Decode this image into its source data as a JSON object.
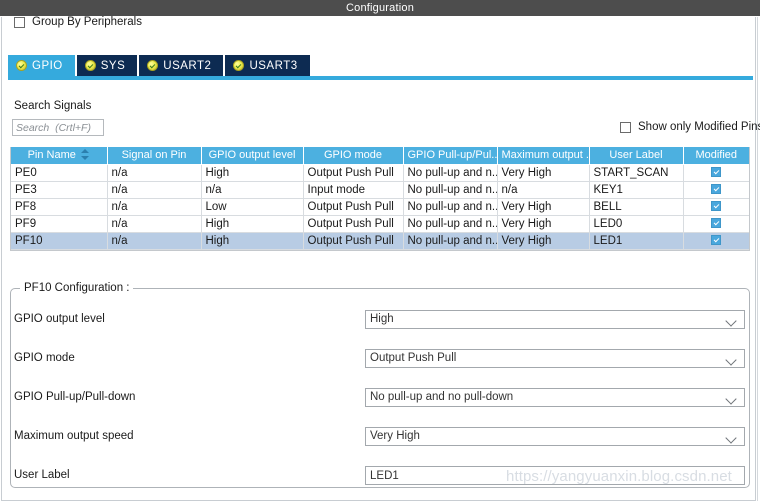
{
  "window": {
    "title": "Configuration"
  },
  "options": {
    "group_by_peripherals_label": "Group By Peripherals",
    "group_by_peripherals_checked": false,
    "show_only_modified_label": "Show only Modified Pins",
    "show_only_modified_checked": false
  },
  "tabs": [
    {
      "label": "GPIO",
      "active": true,
      "status": "configured"
    },
    {
      "label": "SYS",
      "active": false,
      "status": "configured"
    },
    {
      "label": "USART2",
      "active": false,
      "status": "configured"
    },
    {
      "label": "USART3",
      "active": false,
      "status": "configured"
    }
  ],
  "search": {
    "label": "Search Signals",
    "value": "",
    "placeholder": "Search  (Crtl+F)"
  },
  "table": {
    "columns": [
      "Pin Name",
      "Signal on Pin",
      "GPIO output level",
      "GPIO mode",
      "GPIO Pull-up/Pul...",
      "Maximum output ...",
      "User Label",
      "Modified"
    ],
    "sorted_column": "Pin Name",
    "rows": [
      {
        "pin_name": "PE0",
        "signal_on_pin": "n/a",
        "gpio_output_level": "High",
        "gpio_mode": "Output Push Pull",
        "gpio_pull": "No pull-up and n...",
        "max_output_speed": "Very High",
        "user_label": "START_SCAN",
        "modified": true,
        "selected": false
      },
      {
        "pin_name": "PE3",
        "signal_on_pin": "n/a",
        "gpio_output_level": "n/a",
        "gpio_mode": "Input mode",
        "gpio_pull": "No pull-up and n...",
        "max_output_speed": "n/a",
        "user_label": "KEY1",
        "modified": true,
        "selected": false
      },
      {
        "pin_name": "PF8",
        "signal_on_pin": "n/a",
        "gpio_output_level": "Low",
        "gpio_mode": "Output Push Pull",
        "gpio_pull": "No pull-up and n...",
        "max_output_speed": "Very High",
        "user_label": "BELL",
        "modified": true,
        "selected": false
      },
      {
        "pin_name": "PF9",
        "signal_on_pin": "n/a",
        "gpio_output_level": "High",
        "gpio_mode": "Output Push Pull",
        "gpio_pull": "No pull-up and n...",
        "max_output_speed": "Very High",
        "user_label": "LED0",
        "modified": true,
        "selected": false
      },
      {
        "pin_name": "PF10",
        "signal_on_pin": "n/a",
        "gpio_output_level": "High",
        "gpio_mode": "Output Push Pull",
        "gpio_pull": "No pull-up and n...",
        "max_output_speed": "Very High",
        "user_label": "LED1",
        "modified": true,
        "selected": true
      }
    ]
  },
  "detail": {
    "legend": "PF10 Configuration :",
    "fields": [
      {
        "label": "GPIO output level",
        "value": "High",
        "type": "dropdown"
      },
      {
        "label": "GPIO mode",
        "value": "Output Push Pull",
        "type": "dropdown"
      },
      {
        "label": "GPIO Pull-up/Pull-down",
        "value": "No pull-up and no pull-down",
        "type": "dropdown"
      },
      {
        "label": "Maximum output speed",
        "value": "Very High",
        "type": "dropdown"
      },
      {
        "label": "User Label",
        "value": "LED1",
        "type": "text"
      }
    ]
  },
  "watermark": {
    "text": "https://yangyuanxin.blog.csdn.net"
  },
  "colors": {
    "titlebar": "#4d4d4d",
    "accent": "#35aadd",
    "table_header": "#4cb0e0",
    "tab_inactive": "#0d2b52",
    "row_selected": "#b8cce4"
  }
}
